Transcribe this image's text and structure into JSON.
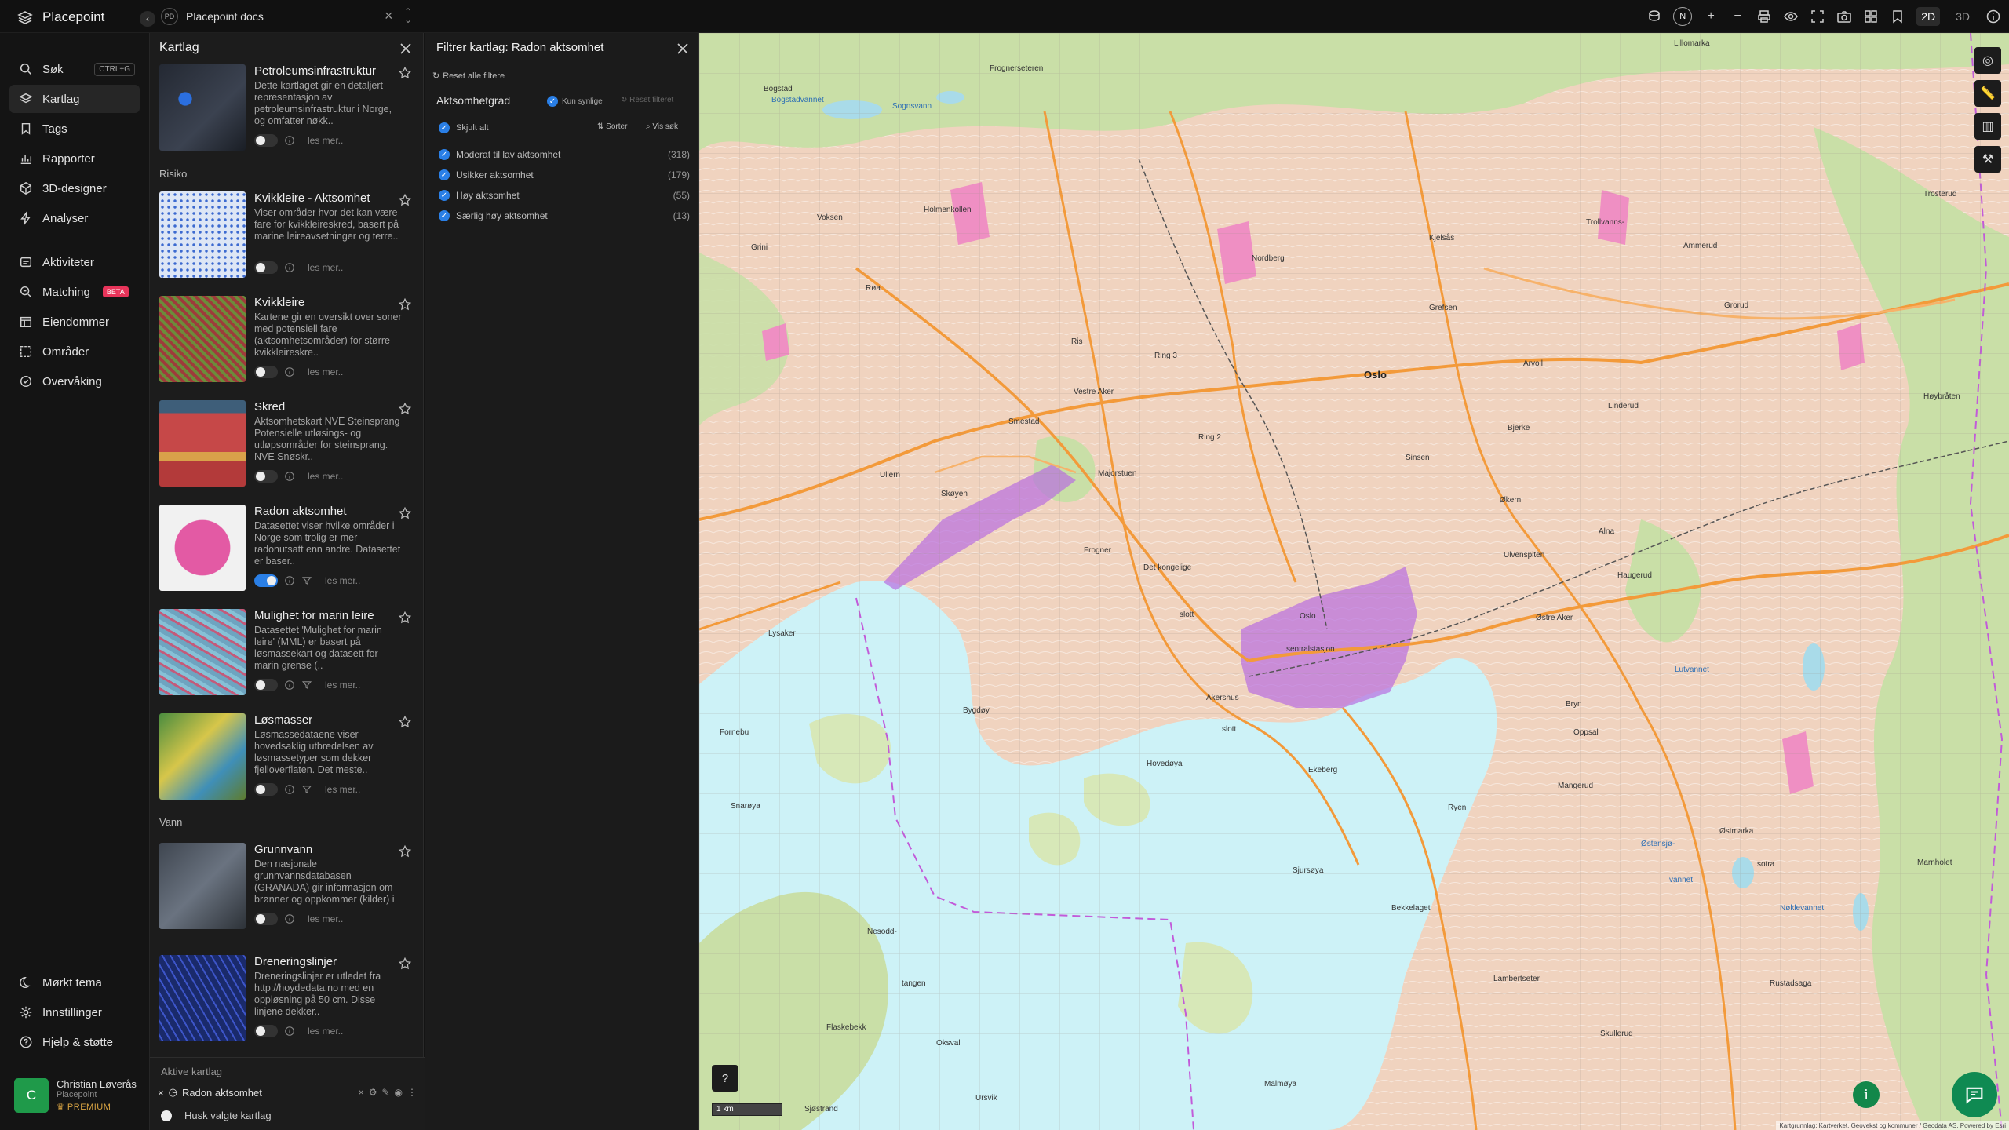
{
  "app": {
    "brand": "Placepoint"
  },
  "workspace": {
    "initials": "PD",
    "name": "Placepoint docs"
  },
  "nav": {
    "items": [
      {
        "label": "Søk",
        "shortcut": "CTRL+G"
      },
      {
        "label": "Kartlag"
      },
      {
        "label": "Tags"
      },
      {
        "label": "Rapporter"
      },
      {
        "label": "3D-designer"
      },
      {
        "label": "Analyser"
      },
      {
        "label": "Aktiviteter"
      },
      {
        "label": "Matching",
        "badge": "BETA"
      },
      {
        "label": "Eiendommer"
      },
      {
        "label": "Områder"
      },
      {
        "label": "Overvåking"
      }
    ],
    "bottom": [
      {
        "label": "Mørkt tema"
      },
      {
        "label": "Innstillinger"
      },
      {
        "label": "Hjelp & støtte"
      }
    ]
  },
  "user": {
    "initial": "C",
    "name": "Christian Løverås",
    "org": "Placepoint",
    "tier": "PREMIUM"
  },
  "layers_panel": {
    "title": "Kartlag",
    "sections": [
      "Risiko",
      "Vann"
    ],
    "read_more": "les mer..",
    "cards": [
      {
        "title": "Petroleumsinfrastruktur",
        "desc": "Dette kartlaget gir en detaljert representasjon av petroleumsinfrastruktur i Norge, og omfatter nøkk..",
        "on": false,
        "filter": false
      },
      {
        "title": "Kvikkleire - Aktsomhet",
        "desc": "Viser områder hvor det kan være fare for kvikkleireskred, basert på marine leireavsetninger og terre..",
        "on": false,
        "filter": false
      },
      {
        "title": "Kvikkleire",
        "desc": "Kartene gir en oversikt over soner med potensiell fare (aktsomhetsområder) for større kvikkleireskre..",
        "on": false,
        "filter": false
      },
      {
        "title": "Skred",
        "desc": "Aktsomhetskart NVE Steinsprang Potensielle utløsings- og utløpsområder for steinsprang. NVE Snøskr..",
        "on": false,
        "filter": false
      },
      {
        "title": "Radon aktsomhet",
        "desc": "Datasettet viser hvilke områder i Norge som trolig er mer radonutsatt enn andre. Datasettet er baser..",
        "on": true,
        "filter": true
      },
      {
        "title": "Mulighet for marin leire",
        "desc": "Datasettet 'Mulighet for marin leire' (MML) er basert på løsmassekart og datasett for marin grense (..",
        "on": false,
        "filter": true
      },
      {
        "title": "Løsmasser",
        "desc": "Løsmassedataene viser hovedsaklig utbredelsen av løsmassetyper som dekker fjelloverflaten. Det meste..",
        "on": false,
        "filter": true
      },
      {
        "title": "Grunnvann",
        "desc": "Den nasjonale grunnvannsdatabasen (GRANADA) gir informasjon om brønner og oppkommer (kilder) i løsma..",
        "on": false,
        "filter": false
      },
      {
        "title": "Dreneringslinjer",
        "desc": "Dreneringslinjer er utledet fra http://hoydedata.no med en oppløsning på 50 cm. Disse linjene dekker..",
        "on": false,
        "filter": false
      }
    ],
    "active_title": "Aktive kartlag",
    "active_layer": "Radon aktsomhet",
    "remember": "Husk valgte kartlag"
  },
  "filter_panel": {
    "title": "Filtrer kartlag: Radon aktsomhet",
    "reset_all": "Reset alle filtere",
    "group": "Aktsomhetgrad",
    "only_visible": "Kun synlige",
    "reset_filter": "Reset filteret",
    "hide_all": "Skjult alt",
    "sort": "Sorter",
    "show_search": "Vis søk",
    "rows": [
      {
        "label": "Moderat til lav aktsomhet",
        "count": "(318)"
      },
      {
        "label": "Usikker aktsomhet",
        "count": "(179)"
      },
      {
        "label": "Høy aktsomhet",
        "count": "(55)"
      },
      {
        "label": "Særlig høy aktsomhet",
        "count": "(13)"
      }
    ]
  },
  "map": {
    "scale": "1 km",
    "attribution": "Kartgrunnlag: Kartverket, Geovekst og kommuner / Geodata AS, Powered by Esri",
    "modes": {
      "two_d": "2D",
      "three_d": "3D"
    },
    "compass": "N",
    "labels": {
      "oslo": "Oslo",
      "sentral": "sentralstasjon",
      "oslo_s": "Oslo",
      "holmenkollen": "Holmenkollen",
      "nordberg": "Nordberg",
      "grefsen": "Grefsen",
      "vestre_aker": "Vestre Aker",
      "smestad": "Smestad",
      "ullern": "Ullern",
      "skoyen": "Skøyen",
      "majorstuen": "Majorstuen",
      "frogner": "Frogner",
      "det_kongelige": "Det kongelige",
      "slott": "slott",
      "akershus": "Akershus",
      "slott2": "slott",
      "bygdoy": "Bygdøy",
      "hovedoya": "Hovedøya",
      "ekeberg": "Ekeberg",
      "sjursoya": "Sjursøya",
      "nesodd": "Nesodd-",
      "tangen": "tangen",
      "flaskebekk": "Flaskebekk",
      "oksval": "Oksval",
      "ursvik": "Ursvik",
      "sjostrand": "Sjøstrand",
      "malmoya": "Malmøya",
      "ryen": "Ryen",
      "bryn": "Bryn",
      "ostre_aker": "Østre Aker",
      "haugerud": "Haugerud",
      "ulven": "Ulvenspiten",
      "linderud": "Linderud",
      "arvoll": "Arvoll",
      "ammerud": "Ammerud",
      "grorud": "Grorud",
      "hoybraten": "Høybråten",
      "trosterud": "Trosterud",
      "ostmarka": "Østmarka",
      "lutvannet": "Lutvannet",
      "ostensjo": "Østensjø-",
      "vannet": "vannet",
      "noklevannet": "Nøklevannet",
      "lillomarka": "Lillomarka",
      "frognerseteren": "Frognerseteren",
      "sognsvann": "Sognsvann",
      "bogstad": "Bogstad",
      "bogstadvannet": "Bogstadvannet",
      "mangerud": "Mangerud",
      "lambertseter": "Lambertseter",
      "skullerud": "Skullerud",
      "rustadsaga": "Rustadsaga",
      "bekkelaget": "Bekkelaget",
      "opsal": "Oppsal",
      "lysaker": "Lysaker",
      "fornebu": "Fornebu",
      "snaroya": "Snarøya",
      "ris": "Ris",
      "roa": "Røa",
      "kjelsas": "Kjelsås",
      "sinsen": "Sinsen",
      "okern": "Økern",
      "bjerke": "Bjerke",
      "alna": "Alna",
      "voksen": "Voksen",
      "grini": "Grini",
      "trollvann": "Trollvanns-",
      "ring2": "Ring 2",
      "ring3": "Ring 3",
      "marnholet": "Marnholet",
      "sotra": "sotra"
    }
  }
}
